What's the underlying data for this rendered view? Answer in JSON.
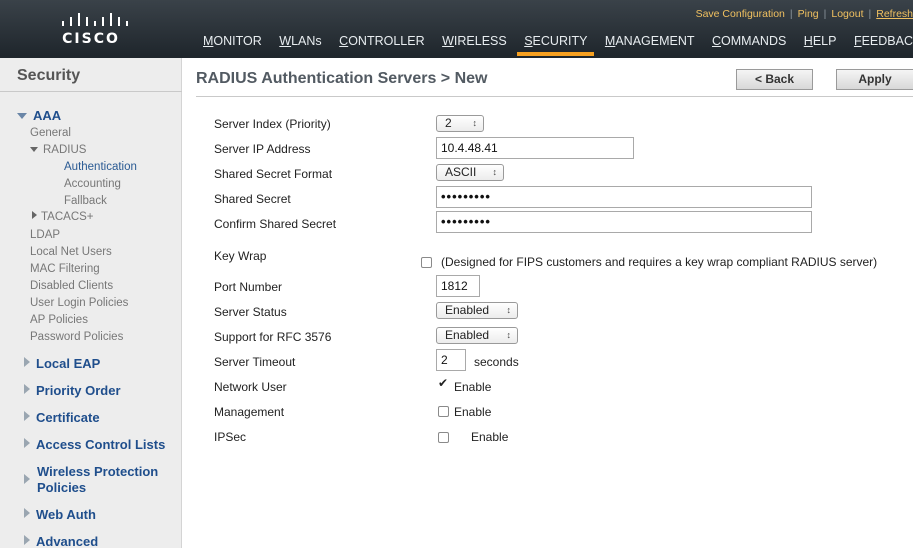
{
  "brand": {
    "name": "CISCO"
  },
  "utility": {
    "save_config": "Save Configuration",
    "ping": "Ping",
    "logout": "Logout",
    "refresh": "Refresh"
  },
  "nav": {
    "items": [
      "MONITOR",
      "WLANs",
      "CONTROLLER",
      "WIRELESS",
      "SECURITY",
      "MANAGEMENT",
      "COMMANDS",
      "HELP",
      "FEEDBACK"
    ],
    "active": "SECURITY"
  },
  "sidebar": {
    "title": "Security",
    "aaa": {
      "label": "AAA",
      "general": "General",
      "radius": "RADIUS",
      "authentication": "Authentication",
      "accounting": "Accounting",
      "fallback": "Fallback",
      "tacacs": "TACACS+",
      "ldap": "LDAP",
      "local_net_users": "Local Net Users",
      "mac_filtering": "MAC Filtering",
      "disabled_clients": "Disabled Clients",
      "user_login_policies": "User Login Policies",
      "ap_policies": "AP Policies",
      "password_policies": "Password Policies"
    },
    "sections": [
      "Local EAP",
      "Priority Order",
      "Certificate",
      "Access Control Lists",
      "Wireless Protection Policies",
      "Web Auth",
      "Advanced"
    ]
  },
  "page": {
    "title": "RADIUS Authentication Servers > New",
    "back_button": "< Back",
    "apply_button": "Apply"
  },
  "form": {
    "server_index_label": "Server Index (Priority)",
    "server_index_value": "2",
    "server_ip_label": "Server IP Address",
    "server_ip_value": "10.4.48.41",
    "secret_format_label": "Shared Secret Format",
    "secret_format_value": "ASCII",
    "shared_secret_label": "Shared Secret",
    "shared_secret_value": "•••••••••",
    "confirm_secret_label": "Confirm Shared Secret",
    "confirm_secret_value": "•••••••••",
    "key_wrap_label": "Key Wrap",
    "key_wrap_note": "(Designed for FIPS customers and requires a key wrap compliant RADIUS server)",
    "key_wrap_checked": false,
    "port_label": "Port Number",
    "port_value": "1812",
    "server_status_label": "Server Status",
    "server_status_value": "Enabled",
    "rfc_label": "Support for RFC 3576",
    "rfc_value": "Enabled",
    "timeout_label": "Server Timeout",
    "timeout_value": "2",
    "timeout_unit": "seconds",
    "network_user_label": "Network User",
    "network_user_enable": "Enable",
    "network_user_checked": true,
    "management_label": "Management",
    "management_enable": "Enable",
    "management_checked": false,
    "ipsec_label": "IPSec",
    "ipsec_enable": "Enable",
    "ipsec_checked": false
  },
  "colors": {
    "topbar": "#2a3239",
    "active_tab_underline": "#f7a020",
    "utility_link": "#f0c060",
    "sidebar_heading": "#1f4e8c",
    "sidebar_bg": "#ededed"
  }
}
